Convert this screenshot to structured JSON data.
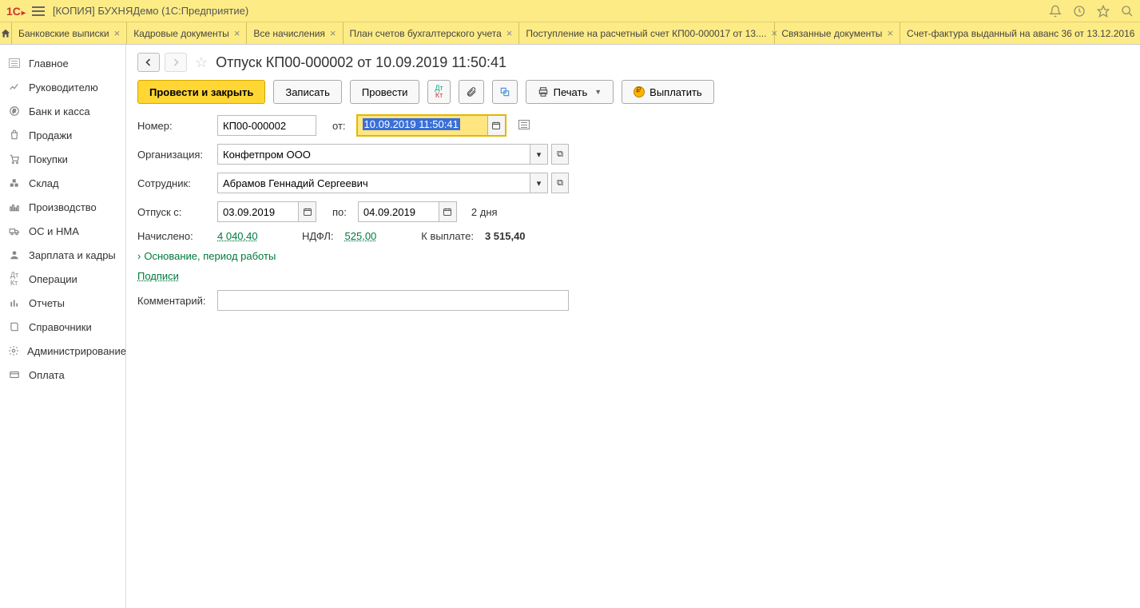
{
  "window_title": "[КОПИЯ] БУХНЯДемо  (1С:Предприятие)",
  "tabs": [
    {
      "label": "Банковские выписки"
    },
    {
      "label": "Кадровые документы"
    },
    {
      "label": "Все начисления"
    },
    {
      "label": "План счетов бухгалтерского учета"
    },
    {
      "label": "Поступление на расчетный счет КП00-000017 от 13...."
    },
    {
      "label": "Связанные документы"
    },
    {
      "label": "Счет-фактура выданный на аванс 36 от 13.12.2016"
    }
  ],
  "sidebar": {
    "items": [
      {
        "label": "Главное"
      },
      {
        "label": "Руководителю"
      },
      {
        "label": "Банк и касса"
      },
      {
        "label": "Продажи"
      },
      {
        "label": "Покупки"
      },
      {
        "label": "Склад"
      },
      {
        "label": "Производство"
      },
      {
        "label": "ОС и НМА"
      },
      {
        "label": "Зарплата и кадры"
      },
      {
        "label": "Операции"
      },
      {
        "label": "Отчеты"
      },
      {
        "label": "Справочники"
      },
      {
        "label": "Администрирование"
      },
      {
        "label": "Оплата"
      }
    ]
  },
  "page": {
    "title": "Отпуск КП00-000002 от 10.09.2019 11:50:41"
  },
  "toolbar": {
    "post_close": "Провести и закрыть",
    "save": "Записать",
    "post": "Провести",
    "print": "Печать",
    "pay": "Выплатить"
  },
  "form": {
    "number_label": "Номер:",
    "number_value": "КП00-000002",
    "from_label": "от:",
    "date_value": "10.09.2019 11:50:41",
    "org_label": "Организация:",
    "org_value": "Конфетпром ООО",
    "emp_label": "Сотрудник:",
    "emp_value": "Абрамов Геннадий Сергеевич",
    "vac_from_label": "Отпуск с:",
    "vac_from_value": "03.09.2019",
    "vac_to_label": "по:",
    "vac_to_value": "04.09.2019",
    "days_text": "2 дня",
    "accrued_label": "Начислено:",
    "accrued_value": "4 040,40",
    "ndfl_label": "НДФЛ:",
    "ndfl_value": "525,00",
    "payout_label": "К выплате:",
    "payout_value": "3 515,40",
    "basis_link": "Основание, период работы",
    "signatures_link": "Подписи",
    "comment_label": "Комментарий:",
    "comment_value": ""
  }
}
